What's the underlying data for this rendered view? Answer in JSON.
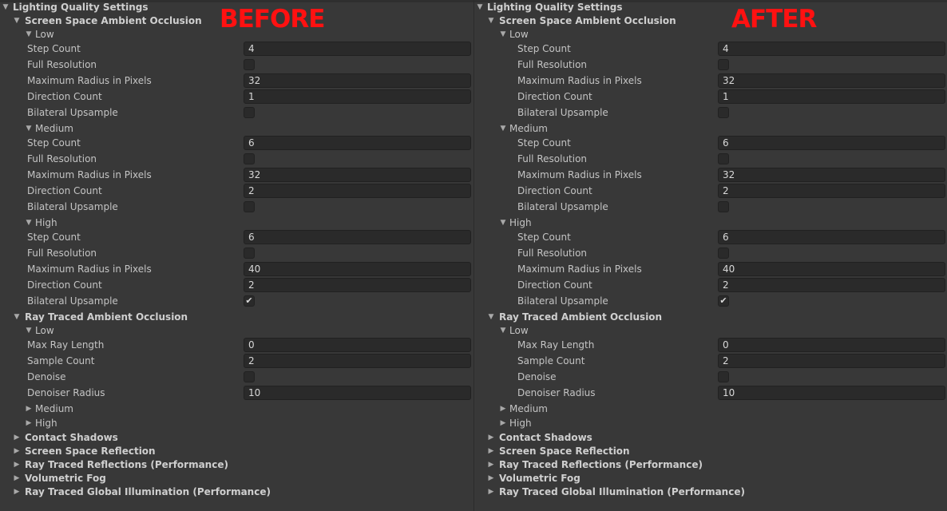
{
  "panels": [
    {
      "id": "before",
      "tag": "BEFORE",
      "rows": [
        {
          "type": "header",
          "level": 0,
          "label": "Lighting Quality Settings",
          "expanded": true
        },
        {
          "type": "header",
          "level": 1,
          "label": "Screen Space Ambient Occlusion",
          "expanded": true
        },
        {
          "type": "group",
          "level": 2,
          "label": "Low",
          "expanded": true
        },
        {
          "type": "field",
          "label": "Step Count",
          "value": "4"
        },
        {
          "type": "check",
          "label": "Full Resolution",
          "checked": false
        },
        {
          "type": "field",
          "label": "Maximum Radius in Pixels",
          "value": "32"
        },
        {
          "type": "field",
          "label": "Direction Count",
          "value": "1"
        },
        {
          "type": "check",
          "label": "Bilateral Upsample",
          "checked": false
        },
        {
          "type": "group",
          "level": 2,
          "label": "Medium",
          "expanded": true
        },
        {
          "type": "field",
          "label": "Step Count",
          "value": "6"
        },
        {
          "type": "check",
          "label": "Full Resolution",
          "checked": false
        },
        {
          "type": "field",
          "label": "Maximum Radius in Pixels",
          "value": "32"
        },
        {
          "type": "field",
          "label": "Direction Count",
          "value": "2"
        },
        {
          "type": "check",
          "label": "Bilateral Upsample",
          "checked": false
        },
        {
          "type": "group",
          "level": 2,
          "label": "High",
          "expanded": true
        },
        {
          "type": "field",
          "label": "Step Count",
          "value": "6"
        },
        {
          "type": "check",
          "label": "Full Resolution",
          "checked": false
        },
        {
          "type": "field",
          "label": "Maximum Radius in Pixels",
          "value": "40"
        },
        {
          "type": "field",
          "label": "Direction Count",
          "value": "2"
        },
        {
          "type": "check",
          "label": "Bilateral Upsample",
          "checked": true
        },
        {
          "type": "header",
          "level": 1,
          "label": "Ray Traced Ambient Occlusion",
          "expanded": true
        },
        {
          "type": "group",
          "level": 2,
          "label": "Low",
          "expanded": true
        },
        {
          "type": "field",
          "label": "Max Ray Length",
          "value": "0"
        },
        {
          "type": "field",
          "label": "Sample Count",
          "value": "2"
        },
        {
          "type": "check",
          "label": "Denoise",
          "checked": false
        },
        {
          "type": "field",
          "label": "Denoiser Radius",
          "value": "10"
        },
        {
          "type": "group",
          "level": 2,
          "label": "Medium",
          "expanded": false
        },
        {
          "type": "group",
          "level": 2,
          "label": "High",
          "expanded": false
        },
        {
          "type": "header",
          "level": 1,
          "label": "Contact Shadows",
          "expanded": false
        },
        {
          "type": "header",
          "level": 1,
          "label": "Screen Space Reflection",
          "expanded": false
        },
        {
          "type": "header",
          "level": 1,
          "label": "Ray Traced Reflections (Performance)",
          "expanded": false
        },
        {
          "type": "header",
          "level": 1,
          "label": "Volumetric Fog",
          "expanded": false
        },
        {
          "type": "header",
          "level": 1,
          "label": "Ray Traced Global Illumination (Performance)",
          "expanded": false
        }
      ]
    },
    {
      "id": "after",
      "tag": "AFTER",
      "rows": [
        {
          "type": "header",
          "level": 0,
          "label": "Lighting Quality Settings",
          "expanded": true
        },
        {
          "type": "header",
          "level": 1,
          "label": "Screen Space Ambient Occlusion",
          "expanded": true
        },
        {
          "type": "group",
          "level": 2,
          "label": "Low",
          "expanded": true
        },
        {
          "type": "field",
          "label": "Step Count",
          "value": "4",
          "indent": true
        },
        {
          "type": "check",
          "label": "Full Resolution",
          "checked": false,
          "indent": true
        },
        {
          "type": "field",
          "label": "Maximum Radius in Pixels",
          "value": "32",
          "indent": true
        },
        {
          "type": "field",
          "label": "Direction Count",
          "value": "1",
          "indent": true
        },
        {
          "type": "check",
          "label": "Bilateral Upsample",
          "checked": false,
          "indent": true
        },
        {
          "type": "group",
          "level": 2,
          "label": "Medium",
          "expanded": true
        },
        {
          "type": "field",
          "label": "Step Count",
          "value": "6",
          "indent": true
        },
        {
          "type": "check",
          "label": "Full Resolution",
          "checked": false,
          "indent": true
        },
        {
          "type": "field",
          "label": "Maximum Radius in Pixels",
          "value": "32",
          "indent": true
        },
        {
          "type": "field",
          "label": "Direction Count",
          "value": "2",
          "indent": true
        },
        {
          "type": "check",
          "label": "Bilateral Upsample",
          "checked": false,
          "indent": true
        },
        {
          "type": "group",
          "level": 2,
          "label": "High",
          "expanded": true
        },
        {
          "type": "field",
          "label": "Step Count",
          "value": "6",
          "indent": true
        },
        {
          "type": "check",
          "label": "Full Resolution",
          "checked": false,
          "indent": true
        },
        {
          "type": "field",
          "label": "Maximum Radius in Pixels",
          "value": "40",
          "indent": true
        },
        {
          "type": "field",
          "label": "Direction Count",
          "value": "2",
          "indent": true
        },
        {
          "type": "check",
          "label": "Bilateral Upsample",
          "checked": true,
          "indent": true
        },
        {
          "type": "header",
          "level": 1,
          "label": "Ray Traced Ambient Occlusion",
          "expanded": true
        },
        {
          "type": "group",
          "level": 2,
          "label": "Low",
          "expanded": true
        },
        {
          "type": "field",
          "label": "Max Ray Length",
          "value": "0",
          "indent": true
        },
        {
          "type": "field",
          "label": "Sample Count",
          "value": "2",
          "indent": true
        },
        {
          "type": "check",
          "label": "Denoise",
          "checked": false,
          "indent": true
        },
        {
          "type": "field",
          "label": "Denoiser Radius",
          "value": "10",
          "indent": true
        },
        {
          "type": "group",
          "level": 2,
          "label": "Medium",
          "expanded": false
        },
        {
          "type": "group",
          "level": 2,
          "label": "High",
          "expanded": false
        },
        {
          "type": "header",
          "level": 1,
          "label": "Contact Shadows",
          "expanded": false
        },
        {
          "type": "header",
          "level": 1,
          "label": "Screen Space Reflection",
          "expanded": false
        },
        {
          "type": "header",
          "level": 1,
          "label": "Ray Traced Reflections (Performance)",
          "expanded": false
        },
        {
          "type": "header",
          "level": 1,
          "label": "Volumetric Fog",
          "expanded": false
        },
        {
          "type": "header",
          "level": 1,
          "label": "Ray Traced Global Illumination (Performance)",
          "expanded": false
        }
      ]
    }
  ],
  "colors": {
    "background": "#383838",
    "field_background": "#2a2a2a",
    "text": "#c4c4c4",
    "tag": "#ff1111"
  },
  "icons": {
    "expanded": "triangle-down-icon",
    "collapsed": "triangle-right-icon",
    "check": "checkmark-icon"
  }
}
